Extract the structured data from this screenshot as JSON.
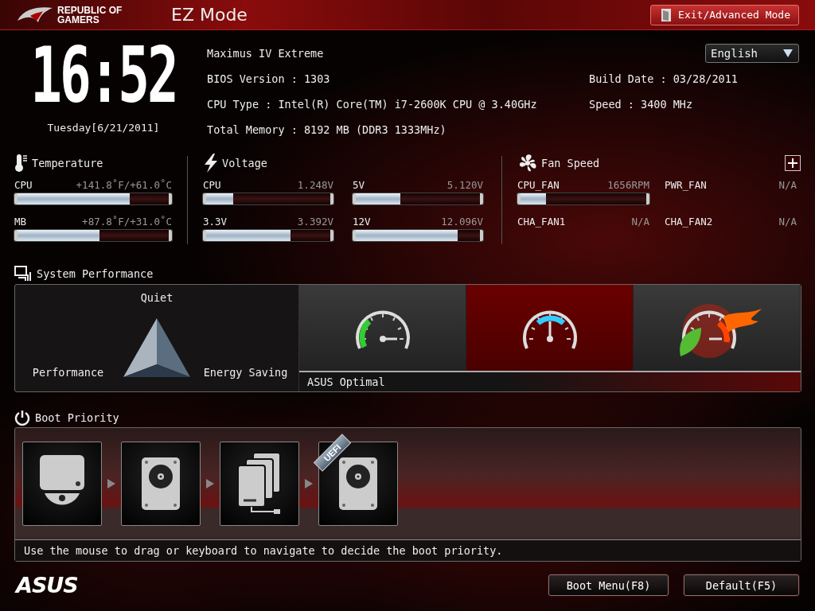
{
  "header": {
    "logo_lines": [
      "REPUBLIC OF",
      "GAMERS"
    ],
    "title": "EZ Mode",
    "exit_button": "Exit/Advanced Mode"
  },
  "clock": {
    "time": "16:52",
    "date": "Tuesday[6/21/2011]"
  },
  "info_left": [
    "Maximus IV Extreme",
    "BIOS Version : 1303",
    "CPU Type : Intel(R) Core(TM) i7-2600K CPU @ 3.40GHz",
    "Total Memory : 8192 MB (DDR3 1333MHz)"
  ],
  "language": {
    "value": "English"
  },
  "info_right": [
    "Build Date : 03/28/2011",
    "Speed : 3400 MHz"
  ],
  "temperature": {
    "title": "Temperature",
    "items": [
      {
        "name": "CPU",
        "reading": "+141.8˚F/+61.0˚C",
        "level": 0.74
      },
      {
        "name": "MB",
        "reading": "+87.8˚F/+31.0˚C",
        "level": 0.54
      }
    ]
  },
  "voltage": {
    "title": "Voltage",
    "items": [
      {
        "name": "CPU",
        "reading": "1.248V",
        "level": 0.22
      },
      {
        "name": "5V",
        "reading": "5.120V",
        "level": 0.36
      },
      {
        "name": "3.3V",
        "reading": "3.392V",
        "level": 0.68
      },
      {
        "name": "12V",
        "reading": "12.096V",
        "level": 0.82
      }
    ]
  },
  "fan_speed": {
    "title": "Fan Speed",
    "items": [
      {
        "name": "CPU_FAN",
        "reading": "1656RPM",
        "level": 0.2
      },
      {
        "name": "PWR_FAN",
        "reading": "N/A"
      },
      {
        "name": "CHA_FAN1",
        "reading": "N/A"
      },
      {
        "name": "CHA_FAN2",
        "reading": "N/A"
      }
    ]
  },
  "system_performance": {
    "title": "System Performance",
    "labels": {
      "top": "Quiet",
      "left": "Performance",
      "right": "Energy Saving"
    },
    "modes": [
      {
        "kind": "green",
        "selected": false
      },
      {
        "kind": "blue",
        "selected": true
      },
      {
        "kind": "flame",
        "selected": false
      }
    ],
    "caption": "ASUS Optimal"
  },
  "boot_priority": {
    "title": "Boot Priority",
    "devices": [
      {
        "kind": "optical"
      },
      {
        "kind": "hdd"
      },
      {
        "kind": "stack"
      },
      {
        "kind": "hdd",
        "badge": "UEFI"
      }
    ],
    "hint": "Use the mouse to drag or keyboard to navigate to decide the boot priority."
  },
  "footer": {
    "logo": "ASUS",
    "buttons": [
      "Boot Menu(F8)",
      "Default(F5)"
    ]
  }
}
